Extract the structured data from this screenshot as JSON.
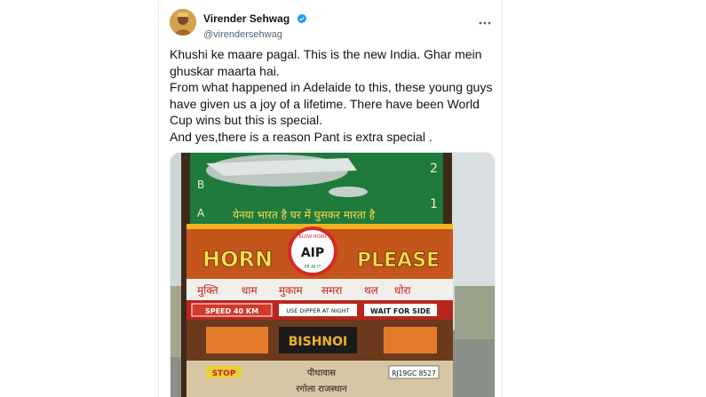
{
  "tweet": {
    "author": {
      "display_name": "Virender Sehwag",
      "handle": "@virendersehwag",
      "verified": true
    },
    "more_icon": "more-dots-icon",
    "lines": [
      "Khushi ke maare pagal. This is the new India. Ghar mein ghuskar maarta hai.",
      "From what happened in Adelaide to this, these young guys have given us a joy of a lifetime. There have been World Cup wins but this is special.",
      "And yes,there is a reason Pant is extra special ."
    ],
    "media": {
      "truck": {
        "panel_hindi": "येनया भारत है घर में घुसकर मारता है",
        "letters_left": [
          "B",
          "A"
        ],
        "numbers_right": [
          "2",
          "1"
        ],
        "horn": "HORN",
        "please": "PLEASE",
        "badge_top": "AIP",
        "badge_ring_top": "BLOW HORN",
        "badge_ring_bottom": "PE IN IT",
        "places": [
          "मुक्ति",
          "धाम",
          "मुकाम",
          "समरा",
          "थल",
          "धोरा"
        ],
        "speed": "SPEED 40 KM",
        "dipper": "USE DIPPER AT NIGHT",
        "wait": "WAIT FOR SIDE",
        "name": "BISHNOI",
        "stop": "STOP",
        "town": "पीथावास",
        "district": "रगोला राजस्थान",
        "plate": "RJ19GC 8527"
      }
    }
  },
  "colors": {
    "text": "#0f1419",
    "secondary": "#536471",
    "verified": "#1d9bf0",
    "border": "#e6ecf0"
  }
}
